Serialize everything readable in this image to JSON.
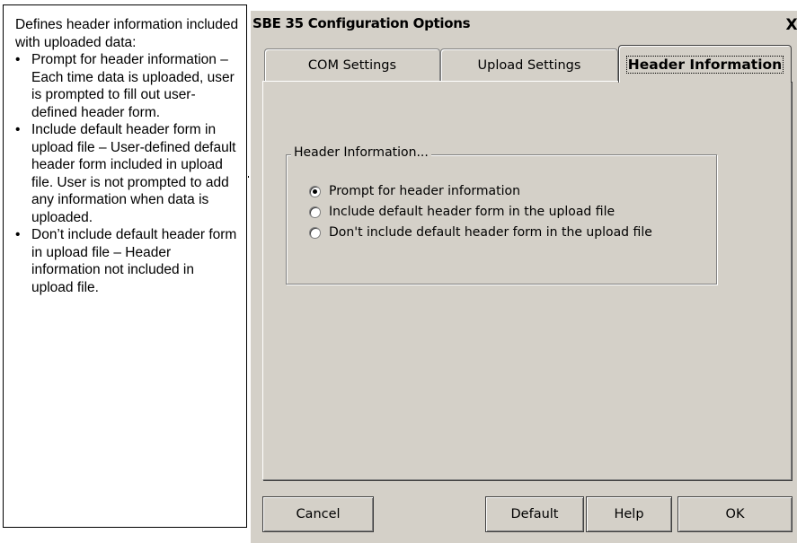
{
  "callout": {
    "intro": "Defines header information included with uploaded data:",
    "bullets": [
      "Prompt for header information – Each time data is uploaded, user is prompted to fill out user-defined header form.",
      "Include default header form in upload file – User-defined default header form included in upload file. User is not prompted to add any information when data is uploaded.",
      "Don’t include default header form in upload file – Header information not included in upload file."
    ]
  },
  "dialog": {
    "title": "SBE 35 Configuration Options",
    "close_label": "X",
    "tabs": [
      {
        "label": "COM Settings",
        "active": false
      },
      {
        "label": "Upload Settings",
        "active": false
      },
      {
        "label": "Header Information",
        "active": true
      }
    ],
    "group": {
      "label": "Header Information...",
      "options": [
        {
          "label": "Prompt for header information",
          "checked": true
        },
        {
          "label": "Include default header form in the upload file",
          "checked": false
        },
        {
          "label": "Don't include default header form in the upload file",
          "checked": false
        }
      ]
    },
    "buttons": {
      "cancel": "Cancel",
      "default": "Default",
      "help": "Help",
      "ok": "OK"
    }
  }
}
